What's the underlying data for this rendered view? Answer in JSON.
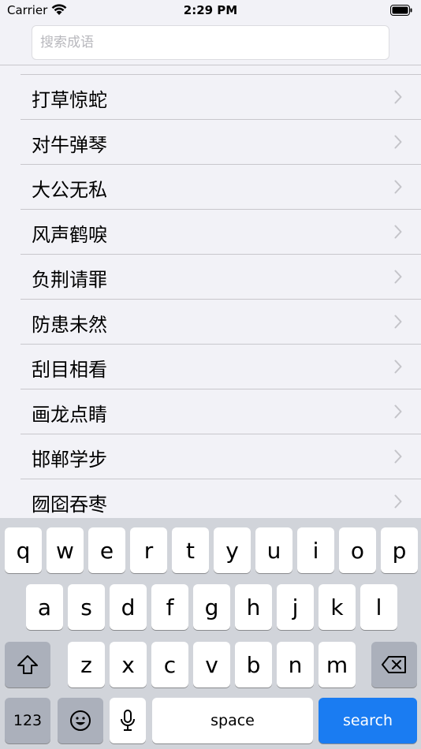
{
  "status": {
    "carrier": "Carrier",
    "time": "2:29 PM"
  },
  "search": {
    "placeholder": "搜索成语",
    "value": ""
  },
  "idioms": [
    {
      "label": "打草惊蛇"
    },
    {
      "label": "对牛弹琴"
    },
    {
      "label": "大公无私"
    },
    {
      "label": "风声鹤唳"
    },
    {
      "label": "负荆请罪"
    },
    {
      "label": "防患未然"
    },
    {
      "label": "刮目相看"
    },
    {
      "label": "画龙点睛"
    },
    {
      "label": "邯郸学步"
    },
    {
      "label": "囫囵吞枣"
    }
  ],
  "keyboard": {
    "row1": [
      "q",
      "w",
      "e",
      "r",
      "t",
      "y",
      "u",
      "i",
      "o",
      "p"
    ],
    "row2": [
      "a",
      "s",
      "d",
      "f",
      "g",
      "h",
      "j",
      "k",
      "l"
    ],
    "row3": [
      "z",
      "x",
      "c",
      "v",
      "b",
      "n",
      "m"
    ],
    "numbers_label": "123",
    "space_label": "space",
    "search_label": "search",
    "icons": {
      "shift": "shift-icon",
      "delete": "delete-icon",
      "emoji": "emoji-icon",
      "mic": "microphone-icon"
    }
  },
  "colors": {
    "search_key": "#1a7cf2",
    "background": "#f2f2f7",
    "keyboard": "#d1d4da"
  }
}
